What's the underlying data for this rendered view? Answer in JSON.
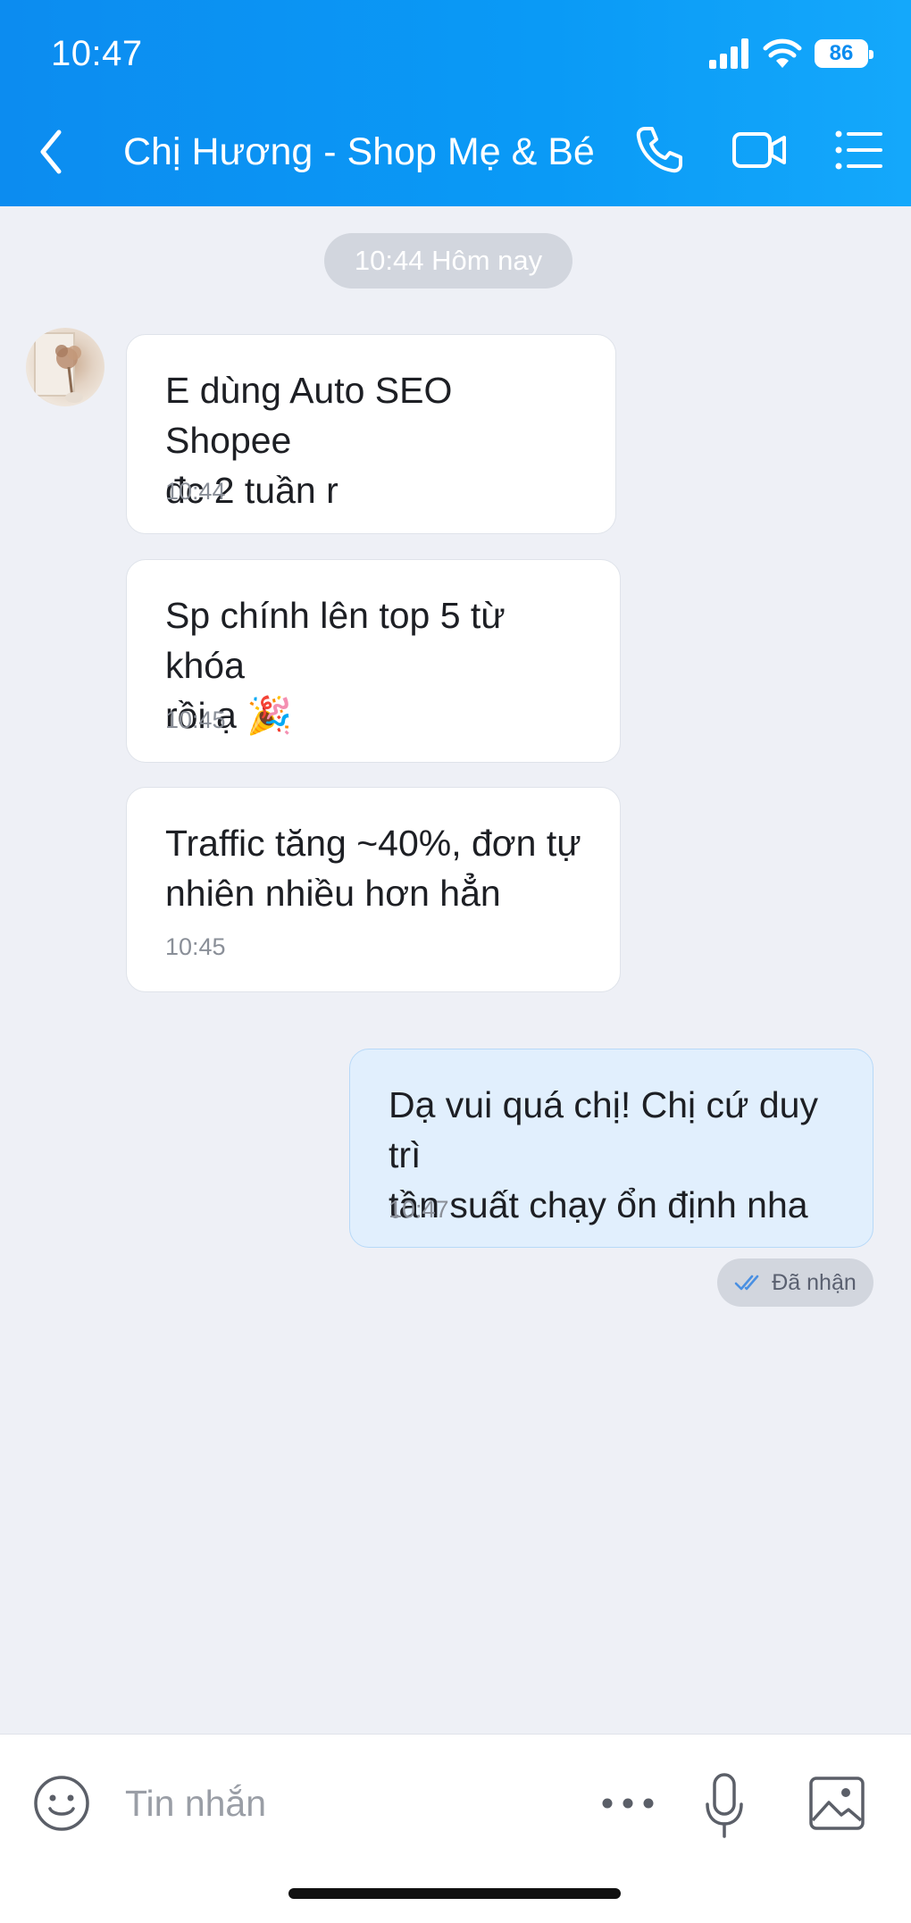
{
  "status_bar": {
    "time": "10:47",
    "battery": "86"
  },
  "header": {
    "title": "Chị Hương - Shop Mẹ & Bé"
  },
  "chat": {
    "date_divider": "10:44 Hôm nay",
    "messages": [
      {
        "direction": "in",
        "text": "E dùng Auto SEO Shopee\nđc 2 tuần r",
        "time": "10:44"
      },
      {
        "direction": "in",
        "text": "Sp chính lên top 5 từ khóa\nrồi ạ 🎉",
        "time": "10:45"
      },
      {
        "direction": "in",
        "text": "Traffic tăng ~40%, đơn tự\nnhiên nhiều hơn hẳn",
        "time": "10:45"
      },
      {
        "direction": "out",
        "text": "Dạ vui quá chị! Chị cứ duy trì\ntần suất chạy ổn định nha",
        "time": "10:47"
      }
    ],
    "delivery_status": "Đã nhận"
  },
  "input_bar": {
    "placeholder": "Tin nhắn"
  },
  "colors": {
    "header_blue": "#0c8cf0",
    "outgoing_bubble": "#e1effd",
    "check_blue": "#4a90e2"
  }
}
